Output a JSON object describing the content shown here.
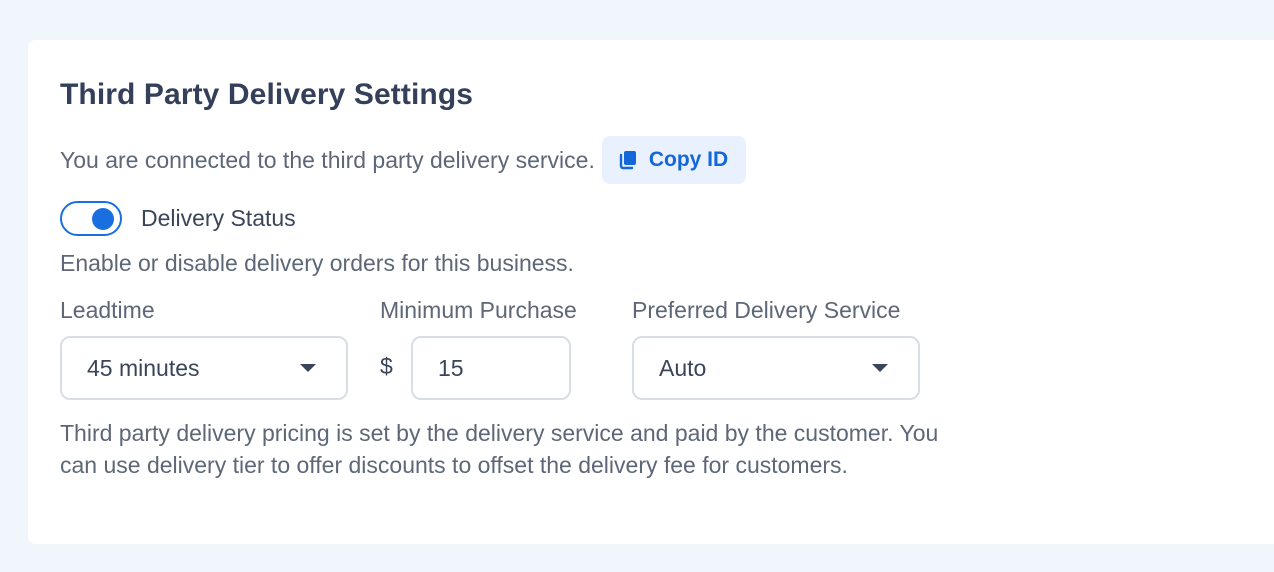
{
  "section": {
    "title": "Third Party Delivery Settings",
    "connected_text": "You are connected to the third party delivery service.",
    "copy_button_label": "Copy ID"
  },
  "delivery_status": {
    "label": "Delivery Status",
    "enabled": true,
    "help_text": "Enable or disable delivery orders for this business."
  },
  "fields": {
    "leadtime": {
      "label": "Leadtime",
      "selected": "45 minutes"
    },
    "minimum_purchase": {
      "label": "Minimum Purchase",
      "currency_symbol": "$",
      "value": "15"
    },
    "preferred_service": {
      "label": "Preferred Delivery Service",
      "selected": "Auto"
    }
  },
  "footnote": "Third party delivery pricing is set by the delivery service and paid by the customer. You can use delivery tier to offer discounts to offset the delivery fee for customers.",
  "colors": {
    "accent": "#1a6fe0",
    "copy_button_bg": "#e8f1fd",
    "page_bg": "#f1f6fd"
  },
  "icons": {
    "copy": "copy-icon",
    "dropdown": "chevron-down-icon"
  }
}
